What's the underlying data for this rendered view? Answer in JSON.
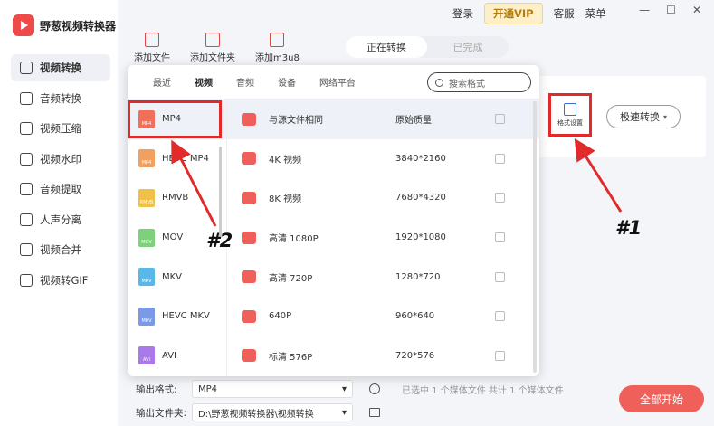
{
  "app": {
    "name": "野葱视频转换器"
  },
  "topbar": {
    "login": "登录",
    "vip": "开通VIP",
    "service": "客服",
    "menu": "菜单"
  },
  "sidebar": {
    "items": [
      {
        "label": "视频转换"
      },
      {
        "label": "音频转换"
      },
      {
        "label": "视频压缩"
      },
      {
        "label": "视频水印"
      },
      {
        "label": "音频提取"
      },
      {
        "label": "人声分离"
      },
      {
        "label": "视频合并"
      },
      {
        "label": "视频转GIF"
      }
    ]
  },
  "toolbar": {
    "add_file": "添加文件",
    "add_folder": "添加文件夹",
    "add_m3u8": "添加m3u8"
  },
  "status_tabs": {
    "converting": "正在转换",
    "done": "已完成"
  },
  "panel": {
    "tabs": [
      "最近",
      "视频",
      "音频",
      "设备",
      "网络平台"
    ],
    "search_placeholder": "搜索格式",
    "formats": [
      {
        "name": "MP4",
        "color": "#f0705a"
      },
      {
        "name": "HEVC MP4",
        "color": "#f0a060"
      },
      {
        "name": "RMVB",
        "color": "#f0c048"
      },
      {
        "name": "MOV",
        "color": "#7fd07a"
      },
      {
        "name": "MKV",
        "color": "#5ab8e8"
      },
      {
        "name": "HEVC MKV",
        "color": "#7a9ae8"
      },
      {
        "name": "AVI",
        "color": "#a97ae8"
      }
    ],
    "resolutions": [
      {
        "name": "与源文件相同",
        "size": "原始质量"
      },
      {
        "name": "4K 视频",
        "size": "3840*2160"
      },
      {
        "name": "8K 视频",
        "size": "7680*4320"
      },
      {
        "name": "高清 1080P",
        "size": "1920*1080"
      },
      {
        "name": "高清 720P",
        "size": "1280*720"
      },
      {
        "name": "640P",
        "size": "960*640"
      },
      {
        "name": "标清 576P",
        "size": "720*576"
      }
    ]
  },
  "right": {
    "format_settings": "格式设置",
    "fast_convert": "极速转换"
  },
  "bottom": {
    "output_format_label": "输出格式:",
    "output_format_value": "MP4",
    "output_folder_label": "输出文件夹:",
    "output_folder_value": "D:\\野葱视频转换器\\视频转换",
    "status": "已选中 1 个媒体文件  共计 1 个媒体文件",
    "start": "全部开始"
  },
  "annotations": {
    "label1": "#1",
    "label2": "#2"
  }
}
